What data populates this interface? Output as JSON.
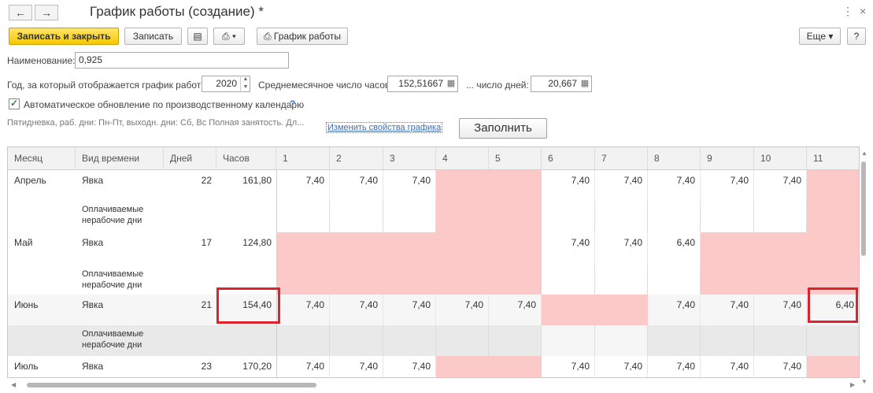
{
  "window": {
    "title": "График работы (создание) *",
    "back_icon": "←",
    "forward_icon": "→",
    "more_icon": "⋮",
    "close_icon": "×"
  },
  "toolbar": {
    "save_close": "Записать и закрыть",
    "save": "Записать",
    "doc_icon": "▤",
    "print_icon": "⎙ ▾",
    "schedule": "График работы",
    "more": "Еще",
    "help": "?"
  },
  "form": {
    "name_label": "Наименование:",
    "name_value": "0,925",
    "year_label": "Год, за который отображается график работы:",
    "year_value": "2020",
    "avg_hours_label": "Среднемесячное число часов:",
    "avg_hours_value": "152,51667",
    "days_label": "... число дней:",
    "days_value": "20,667",
    "auto_update_label": "Автоматическое обновление по производственному календарю",
    "auto_update_checked": true,
    "help_mark": "?",
    "description": "Пятидневка, раб. дни: Пн-Пт, выходн. дни: Сб, Вс Полная занятость. Дл...",
    "change_link": "Изменить свойства графика",
    "fill_button": "Заполнить"
  },
  "table": {
    "columns": [
      "Месяц",
      "Вид времени",
      "Дней",
      "Часов",
      "1",
      "2",
      "3",
      "4",
      "5",
      "6",
      "7",
      "8",
      "9",
      "10",
      "11"
    ],
    "rows": [
      {
        "month": "Апрель",
        "kind": "Явка",
        "days": "22",
        "hours": "161,80",
        "values": [
          "7,40",
          "7,40",
          "7,40",
          "",
          "",
          "7,40",
          "7,40",
          "7,40",
          "7,40",
          "7,40",
          ""
        ],
        "off": [
          false,
          false,
          false,
          true,
          true,
          false,
          false,
          false,
          false,
          false,
          true
        ],
        "sub_kind": "Оплачиваемые нерабочие дни"
      },
      {
        "month": "Май",
        "kind": "Явка",
        "days": "17",
        "hours": "124,80",
        "values": [
          "",
          "",
          "",
          "",
          "",
          "7,40",
          "7,40",
          "6,40",
          "",
          "",
          ""
        ],
        "off": [
          true,
          true,
          true,
          true,
          true,
          false,
          false,
          false,
          true,
          true,
          true
        ],
        "sub_kind": "Оплачиваемые нерабочие дни"
      },
      {
        "month": "Июнь",
        "kind": "Явка",
        "days": "21",
        "hours": "154,40",
        "values": [
          "7,40",
          "7,40",
          "7,40",
          "7,40",
          "7,40",
          "",
          "",
          "7,40",
          "7,40",
          "7,40",
          "6,40"
        ],
        "off": [
          false,
          false,
          false,
          false,
          false,
          true,
          true,
          false,
          false,
          false,
          false
        ],
        "sub_kind": "Оплачиваемые нерабочие дни"
      },
      {
        "month": "Июль",
        "kind": "Явка",
        "days": "23",
        "hours": "170,20",
        "values": [
          "7,40",
          "7,40",
          "7,40",
          "",
          "",
          "7,40",
          "7,40",
          "7,40",
          "7,40",
          "7,40",
          ""
        ],
        "off": [
          false,
          false,
          false,
          true,
          true,
          false,
          false,
          false,
          false,
          false,
          true
        ]
      }
    ]
  },
  "colors": {
    "accent_yellow": "#f6c800",
    "nonworking_pink": "#fcc9c9",
    "highlight_red": "#e0202a",
    "link_blue": "#3b6fb6"
  }
}
